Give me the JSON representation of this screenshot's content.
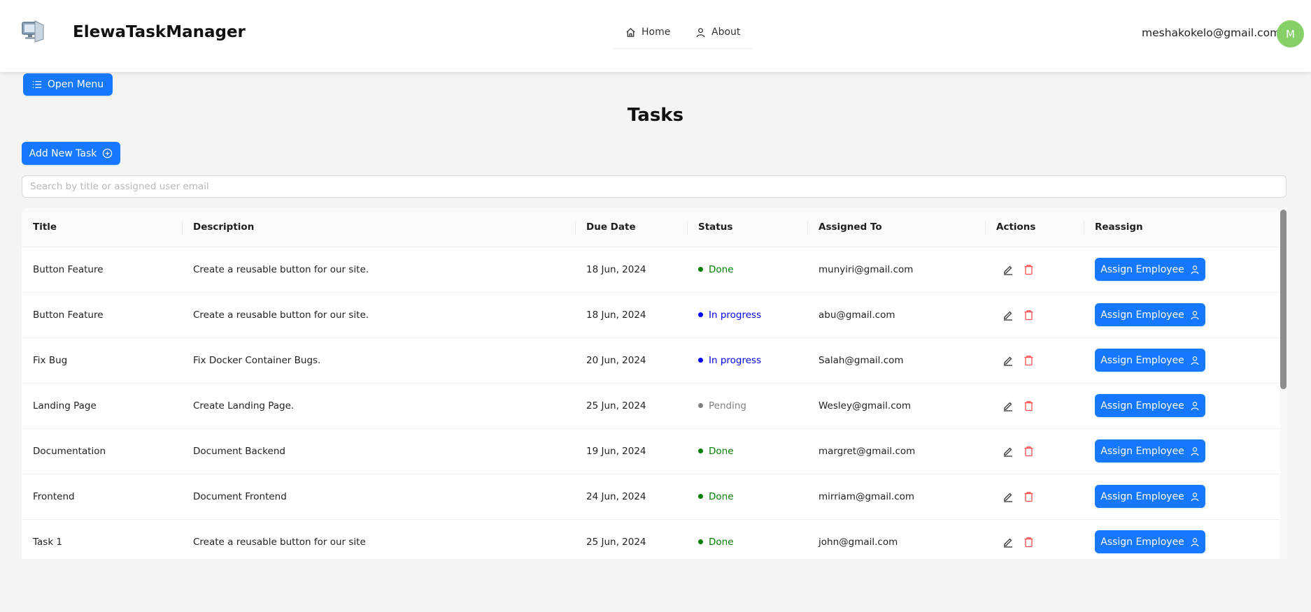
{
  "header": {
    "app_title": "ElewaTaskManager",
    "nav": [
      {
        "label": "Home",
        "icon": "home-icon"
      },
      {
        "label": "About",
        "icon": "user-icon"
      }
    ],
    "user_email": "meshakokelo@gmail.com",
    "avatar_initial": "M",
    "avatar_color": "#87d068"
  },
  "toolbar": {
    "open_menu_label": "Open Menu",
    "add_task_label": "Add New Task"
  },
  "page_title": "Tasks",
  "search": {
    "placeholder": "Search by title or assigned user email",
    "value": ""
  },
  "table": {
    "columns": [
      "Title",
      "Description",
      "Due Date",
      "Status",
      "Assigned To",
      "Actions",
      "Reassign"
    ],
    "assign_label": "Assign Employee",
    "rows": [
      {
        "title": "Button Feature",
        "description": "Create a reusable button for our site.",
        "due": "18 Jun, 2024",
        "status": "Done",
        "assigned": "munyiri@gmail.com"
      },
      {
        "title": "Button Feature",
        "description": "Create a reusable button for our site.",
        "due": "18 Jun, 2024",
        "status": "In progress",
        "assigned": "abu@gmail.com"
      },
      {
        "title": "Fix Bug",
        "description": "Fix Docker Container Bugs.",
        "due": "20 Jun, 2024",
        "status": "In progress",
        "assigned": "Salah@gmail.com"
      },
      {
        "title": "Landing Page",
        "description": "Create Landing Page.",
        "due": "25 Jun, 2024",
        "status": "Pending",
        "assigned": "Wesley@gmail.com"
      },
      {
        "title": "Documentation",
        "description": "Document Backend",
        "due": "19 Jun, 2024",
        "status": "Done",
        "assigned": "margret@gmail.com"
      },
      {
        "title": "Frontend",
        "description": "Document Frontend",
        "due": "24 Jun, 2024",
        "status": "Done",
        "assigned": "mirriam@gmail.com"
      },
      {
        "title": "Task 1",
        "description": "Create a reusable button for our site",
        "due": "25 Jun, 2024",
        "status": "Done",
        "assigned": "john@gmail.com"
      }
    ]
  },
  "colors": {
    "primary": "#1677ff",
    "status_done": "#008000",
    "status_in_progress": "#0000ff",
    "status_pending": "#808080",
    "delete": "#ff4d4f"
  }
}
